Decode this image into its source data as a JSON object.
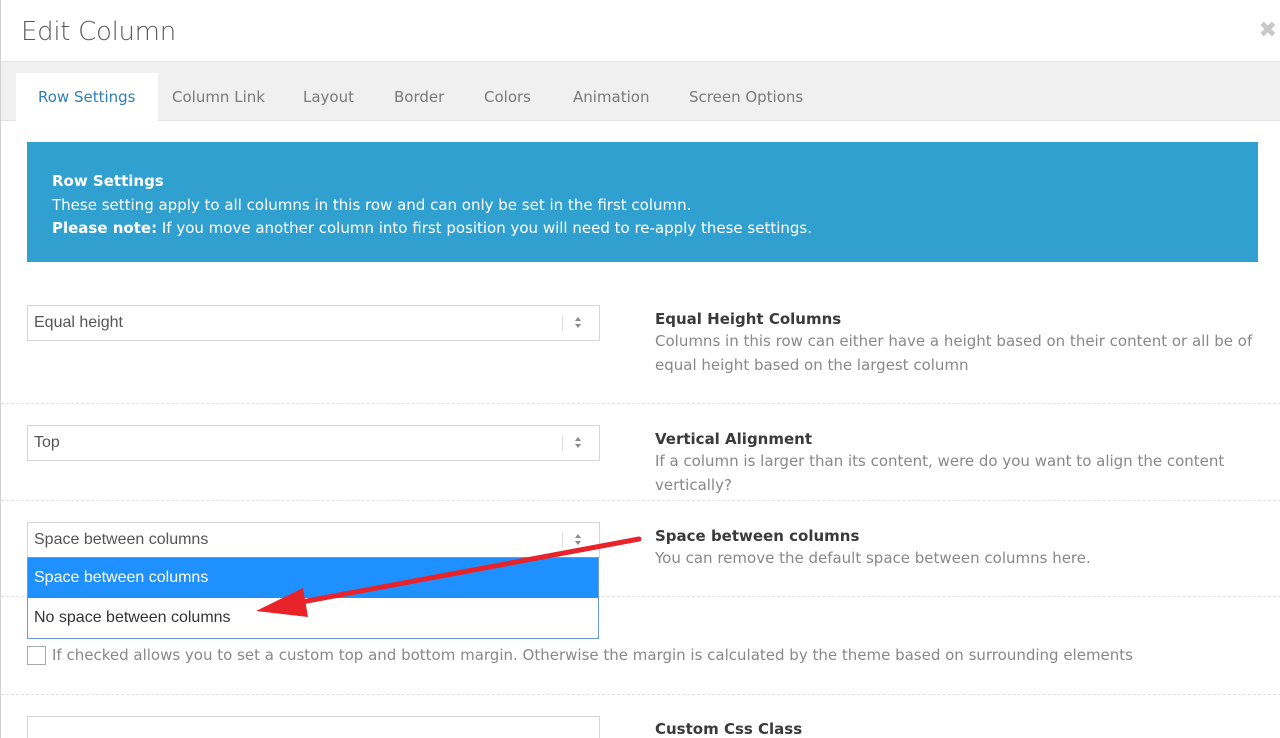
{
  "modal": {
    "title": "Edit Column",
    "close_icon": "close-icon"
  },
  "tabs": [
    {
      "label": "Row Settings",
      "active": true
    },
    {
      "label": "Column Link"
    },
    {
      "label": "Layout"
    },
    {
      "label": "Border"
    },
    {
      "label": "Colors"
    },
    {
      "label": "Animation"
    },
    {
      "label": "Screen Options"
    }
  ],
  "notice": {
    "title": "Row Settings",
    "line1": "These setting apply to all columns in this row and can only be set in the first column.",
    "note_label": "Please note:",
    "note_text": " If you move another column into first position you will need to re-apply these settings."
  },
  "settings": {
    "equal_height": {
      "value": "Equal height",
      "title": "Equal Height Columns",
      "desc": "Columns in this row can either have a height based on their content or all be of equal height based on the largest column"
    },
    "vertical_alignment": {
      "value": "Top",
      "title": "Vertical Alignment",
      "desc": "If a column is larger than its content, were do you want to align the content vertically?"
    },
    "spacing": {
      "value": "Space between columns",
      "title": "Space between columns",
      "desc": "You can remove the default space between columns here.",
      "options": [
        "Space between columns",
        "No space between columns"
      ]
    },
    "custom_margin": {
      "desc": "If checked allows you to set a custom top and bottom margin. Otherwise the margin is calculated by the theme based on surrounding elements"
    },
    "custom_css": {
      "title": "Custom Css Class"
    }
  },
  "colors": {
    "accent": "#2fa0cf",
    "tab_active": "#2e7fb8",
    "option_selected": "#1e90ff",
    "annotation_arrow": "#e8232a"
  }
}
